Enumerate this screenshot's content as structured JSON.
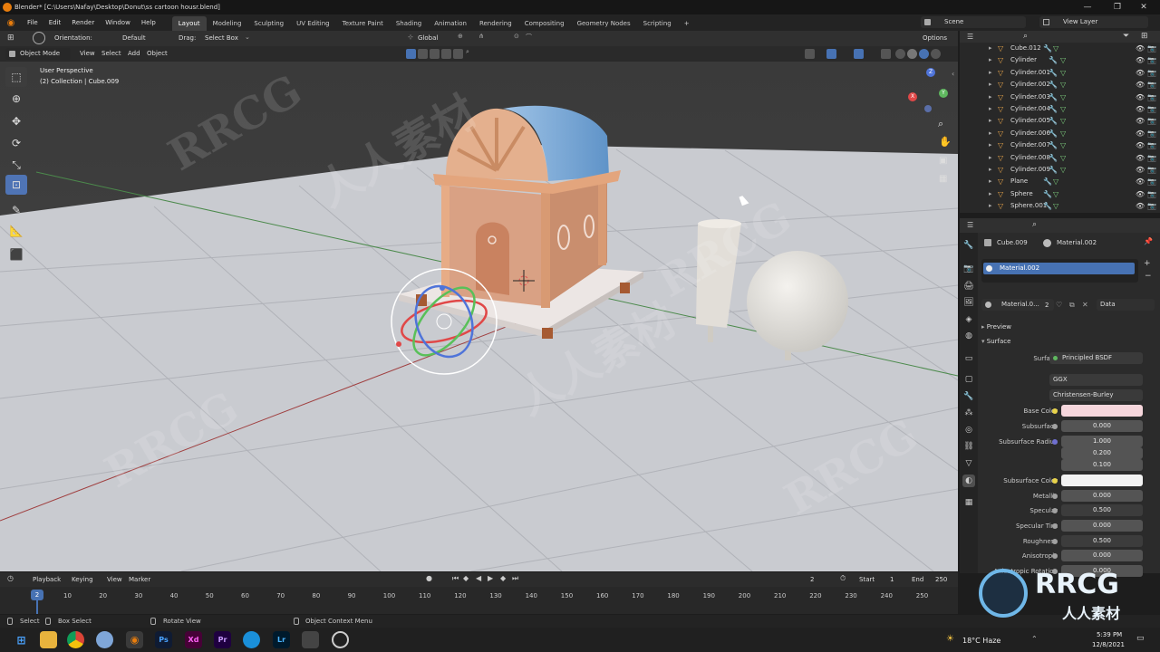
{
  "window": {
    "title": "Blender* [C:\\Users\\Nafay\\Desktop\\Donut\\ss cartoon housr.blend]"
  },
  "menu": {
    "items": [
      "File",
      "Edit",
      "Render",
      "Window",
      "Help"
    ]
  },
  "workspaces": [
    "Layout",
    "Modeling",
    "Sculpting",
    "UV Editing",
    "Texture Paint",
    "Shading",
    "Animation",
    "Rendering",
    "Compositing",
    "Geometry Nodes",
    "Scripting"
  ],
  "workspace_add": "+",
  "scene": {
    "name": "Scene",
    "view_layer": "View Layer"
  },
  "viewport_header": {
    "orientation_label": "Orientation:",
    "orientation_value": "Default",
    "drag_label": "Drag:",
    "drag_value": "Select Box",
    "transform": "Global",
    "options": "Options"
  },
  "viewport_header2": {
    "mode": "Object Mode",
    "view": "View",
    "select": "Select",
    "add": "Add",
    "object": "Object"
  },
  "viewport_info": {
    "line1": "User Perspective",
    "line2": "(2) Collection | Cube.009"
  },
  "gizmo_axes": {
    "x": "X",
    "y": "Y",
    "z": "Z"
  },
  "outliner": {
    "items": [
      {
        "name": "Cube.012"
      },
      {
        "name": "Cylinder"
      },
      {
        "name": "Cylinder.001"
      },
      {
        "name": "Cylinder.002"
      },
      {
        "name": "Cylinder.003"
      },
      {
        "name": "Cylinder.004"
      },
      {
        "name": "Cylinder.005"
      },
      {
        "name": "Cylinder.006"
      },
      {
        "name": "Cylinder.007"
      },
      {
        "name": "Cylinder.008"
      },
      {
        "name": "Cylinder.009"
      },
      {
        "name": "Plane"
      },
      {
        "name": "Sphere"
      },
      {
        "name": "Sphere.001"
      }
    ]
  },
  "properties": {
    "object_name": "Cube.009",
    "material_name": "Material.002",
    "slot_name": "Material.002",
    "material_field": "Material.0...",
    "user_count": "2",
    "data_label": "Data",
    "preview": "Preview",
    "surface_panel": "Surface",
    "surface_label": "Surface",
    "surface_value": "Principled BSDF",
    "distribution": "GGX",
    "subsurface_method": "Christensen-Burley",
    "rows": [
      {
        "label": "Base Color",
        "value": ""
      },
      {
        "label": "Subsurface",
        "value": "0.000"
      },
      {
        "label": "Subsurface Radius",
        "value": "1.000"
      },
      {
        "label": "",
        "value": "0.200"
      },
      {
        "label": "",
        "value": "0.100"
      },
      {
        "label": "Subsurface Color",
        "value": ""
      },
      {
        "label": "Metallic",
        "value": "0.000"
      },
      {
        "label": "Specular",
        "value": "0.500"
      },
      {
        "label": "Specular Tint",
        "value": "0.000"
      },
      {
        "label": "Roughness",
        "value": "0.500"
      },
      {
        "label": "Anisotropic",
        "value": "0.000"
      },
      {
        "label": "Anisotropic Rotation",
        "value": "0.000"
      }
    ],
    "base_color": "#f6d6dc",
    "subsurface_color": "#f2f2f2"
  },
  "timeline": {
    "playback": "Playback",
    "keying": "Keying",
    "view": "View",
    "marker": "Marker",
    "current_frame": "2",
    "start_label": "Start",
    "start": "1",
    "end_label": "End",
    "end": "250",
    "playhead": "2",
    "frames": [
      "10",
      "20",
      "30",
      "40",
      "50",
      "60",
      "70",
      "80",
      "90",
      "100",
      "110",
      "120",
      "130",
      "140",
      "150",
      "160",
      "170",
      "180",
      "190",
      "200",
      "210",
      "220",
      "230",
      "240",
      "250"
    ]
  },
  "statusbar": {
    "select": "Select",
    "box_select": "Box Select",
    "rotate_view": "Rotate View",
    "context_menu": "Object Context Menu"
  },
  "taskbar": {
    "weather": "18°C  Haze",
    "time": "5:39 PM",
    "date": "12/8/2021",
    "apps": [
      "Ps",
      "Xd",
      "Pr",
      "Lr"
    ]
  },
  "watermark": {
    "text_a": "RRCG",
    "text_b": "人人素材"
  },
  "colors": {
    "accent_blue": "#4772b3",
    "active_tool": "#4f74b5",
    "playhead": "#4772b3"
  }
}
